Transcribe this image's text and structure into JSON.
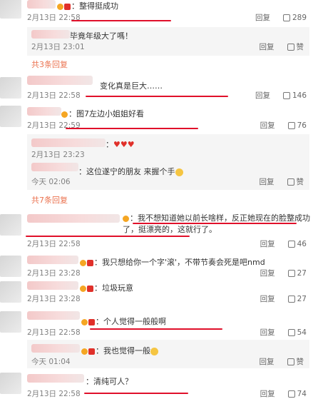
{
  "comments": [
    {
      "text": "：整得挺成功",
      "time": "2月13日 22:58",
      "reply": "回复",
      "likes": "289",
      "replies": [
        {
          "text": "毕竟年级大了嗎！",
          "time": "2月13日 23:01",
          "reply": "回复",
          "like": "赞"
        }
      ],
      "more": "共3条回复"
    },
    {
      "text": "变化真是巨大……",
      "time": "2月13日 22:58",
      "reply": "回复",
      "likes": "146"
    },
    {
      "text": "：图7左边小姐姐好看",
      "time": "2月13日 22:59",
      "reply": "回复",
      "likes": "76",
      "replies": [
        {
          "text": "：",
          "time": "2月13日 23:23",
          "reply": "回复",
          "like": "赞"
        },
        {
          "text": "：这位遂宁的朋友 来握个手",
          "time": "今天 02:06",
          "reply": "回复",
          "like": "赞"
        }
      ],
      "more": "共7条回复"
    },
    {
      "text": "：我不想知道她以前长啥样，反正她现在的脸整成功了，挺漂亮的，这就行了。",
      "time": "2月13日 22:58",
      "reply": "回复",
      "likes": "46"
    },
    {
      "text": "：我只想给你一个字'滚'，不带节奏会死是吧nmd",
      "time": "2月13日 23:28",
      "reply": "回复",
      "likes": "27"
    },
    {
      "text": "：垃圾玩意",
      "time": "2月13日 23:28",
      "reply": "回复",
      "likes": "27"
    },
    {
      "text": "：个人觉得一般般啊",
      "time": "2月13日 22:58",
      "reply": "回复",
      "likes": "54",
      "replies": [
        {
          "text": "：我也觉得一般",
          "time": "今天 01:04",
          "reply": "回复",
          "like": "赞"
        }
      ]
    },
    {
      "text": "：清纯可人？",
      "time": "2月13日 22:58",
      "reply": "回复",
      "likes": "74"
    }
  ],
  "colors": {
    "underline": "#e0102a",
    "more_link": "#eb7350"
  }
}
